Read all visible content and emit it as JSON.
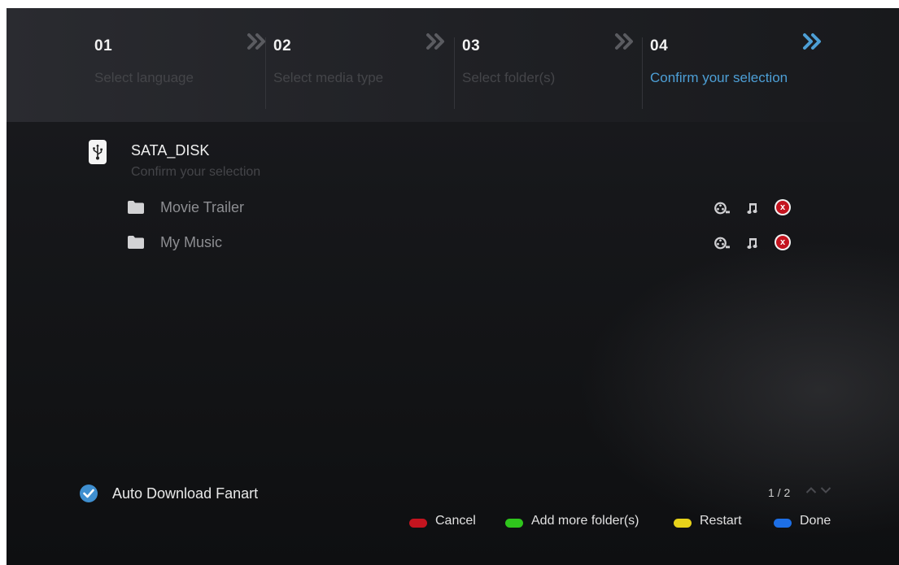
{
  "steps": [
    {
      "number": "01",
      "label": "Select language"
    },
    {
      "number": "02",
      "label": "Select media type"
    },
    {
      "number": "03",
      "label": "Select folder(s)"
    },
    {
      "number": "04",
      "label": "Confirm your selection"
    }
  ],
  "device": {
    "name": "SATA_DISK",
    "subtitle": "Confirm your selection",
    "icon": "usb-icon"
  },
  "folders": [
    {
      "name": "Movie Trailer",
      "media_types": [
        "video-icon",
        "music-icon"
      ]
    },
    {
      "name": "My Music",
      "media_types": [
        "video-icon",
        "music-icon"
      ]
    }
  ],
  "auto_download": {
    "label": "Auto Download Fanart",
    "checked": true
  },
  "pagination": {
    "text": "1 / 2"
  },
  "hints": [
    {
      "label": "Cancel",
      "color": "#c4141f"
    },
    {
      "label": "Add more folder(s)",
      "color": "#2fc51c"
    },
    {
      "label": "Restart",
      "color": "#e7d21a"
    },
    {
      "label": "Done",
      "color": "#1d6fe6"
    }
  ],
  "colors": {
    "accent": "#4d9fd6",
    "step_inactive": "#444549",
    "remove": "#c4141f"
  }
}
